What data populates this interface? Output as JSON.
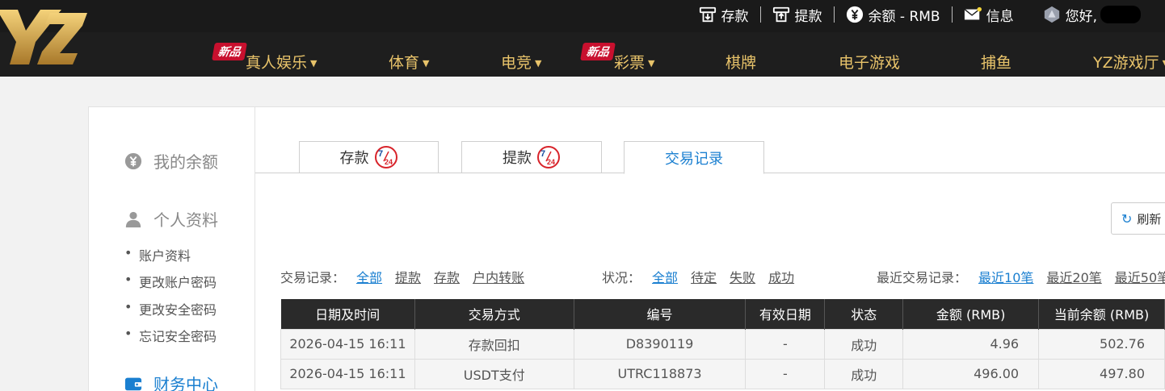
{
  "brand": {
    "logo_text": "YZ",
    "logo_color": "#d4a84a"
  },
  "utility": {
    "deposit": "存款",
    "withdraw": "提款",
    "balance": "余额 - RMB",
    "messages": "信息",
    "greeting": "您好,"
  },
  "nav": {
    "new_badge": "新品",
    "items": [
      "真人娱乐",
      "体育",
      "电竞",
      "彩票",
      "棋牌",
      "电子游戏",
      "捕鱼",
      "YZ游戏厅"
    ]
  },
  "sidebar": {
    "balance": "我的余额",
    "profile": "个人资料",
    "profile_items": [
      "账户资料",
      "更改账户密码",
      "更改安全密码",
      "忘记安全密码"
    ],
    "finance": "财务中心"
  },
  "tabs": {
    "deposit": "存款",
    "withdraw": "提款",
    "records": "交易记录",
    "badge_7": "7",
    "badge_24": "24"
  },
  "refresh": "刷新",
  "filters": {
    "type_label": "交易记录：",
    "type_options": [
      "全部",
      "提款",
      "存款",
      "户内转账"
    ],
    "status_label": "状况：",
    "status_options": [
      "全部",
      "待定",
      "失败",
      "成功"
    ],
    "recent_label": "最近交易记录：",
    "recent_options": [
      "最近10笔",
      "最近20笔",
      "最近50笔"
    ]
  },
  "table": {
    "headers": [
      "日期及时间",
      "交易方式",
      "编号",
      "有效日期",
      "状态",
      "金额 (RMB)",
      "当前余额 (RMB)"
    ],
    "rows": [
      [
        "2026-04-15 16:11",
        "存款回扣",
        "D8390119",
        "-",
        "成功",
        "4.96",
        "502.76"
      ],
      [
        "2026-04-15 16:11",
        "USDT支付",
        "UTRC118873",
        "-",
        "成功",
        "496.00",
        "497.80"
      ]
    ]
  },
  "colors": {
    "accent": "#1a7fd0",
    "nav_gold": "#e8c36a",
    "badge_red": "#c8102e"
  }
}
